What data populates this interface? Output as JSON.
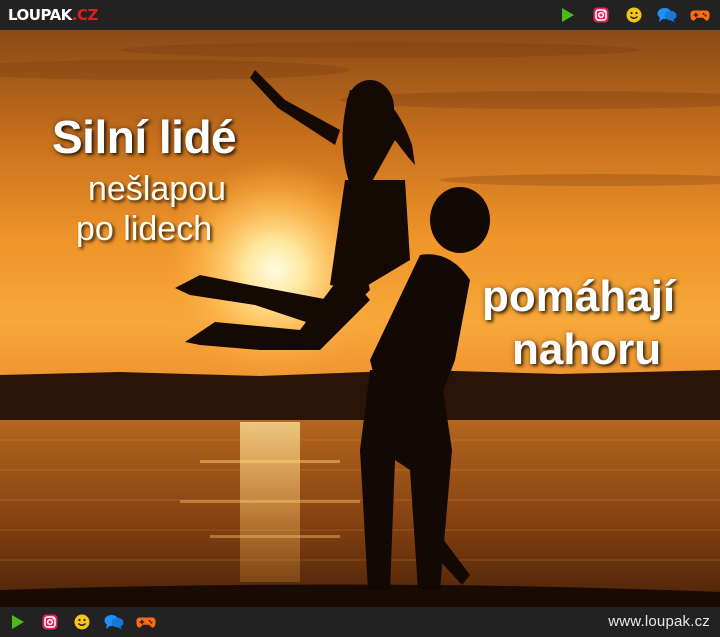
{
  "header": {
    "logo_main": "LOUPAK",
    "logo_tld": ".CZ"
  },
  "icons": [
    "play-icon",
    "instagram-icon",
    "smiley-icon",
    "chat-icon",
    "gamepad-icon"
  ],
  "colors": {
    "bar_bg": "#222223",
    "play": "#4cbb17",
    "instagram": "#e0245e",
    "smiley": "#f5c518",
    "chat": "#1e90ff",
    "gamepad": "#ff6a13",
    "logo_accent": "#e21b23"
  },
  "captions": {
    "left_title": "Silní lidé",
    "left_line1": "nešlapou",
    "left_line2": "po lidech",
    "right_line1": "pomáhají",
    "right_line2": "nahoru"
  },
  "footer": {
    "url": "www.loupak.cz"
  }
}
